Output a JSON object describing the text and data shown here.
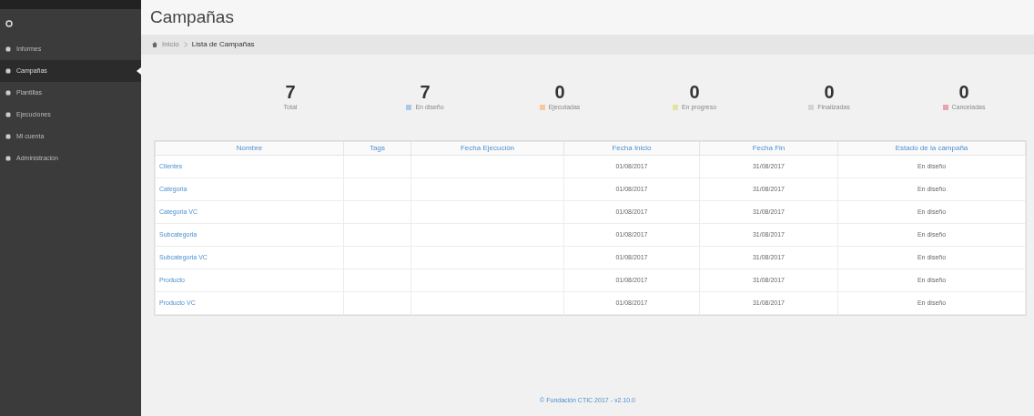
{
  "sidebar": {
    "items": [
      {
        "label": "Informes",
        "selected": false
      },
      {
        "label": "Campañas",
        "selected": true
      },
      {
        "label": "Plantillas",
        "selected": false
      },
      {
        "label": "Ejecuciones",
        "selected": false
      },
      {
        "label": "Mi cuenta",
        "selected": false
      },
      {
        "label": "Administración",
        "selected": false
      }
    ]
  },
  "page_title": "Campañas",
  "breadcrumb": [
    "Inicio",
    "Lista de Campañas"
  ],
  "stats": [
    {
      "value": "7",
      "label": "Total"
    },
    {
      "value": "7",
      "label": "En diseño",
      "color": "#a9cbe8"
    },
    {
      "value": "0",
      "label": "Ejecutadas",
      "color": "#f5c99b"
    },
    {
      "value": "0",
      "label": "En progreso",
      "color": "#e3e3a8"
    },
    {
      "value": "0",
      "label": "Finalizadas",
      "color": "#d4d4d4"
    },
    {
      "value": "0",
      "label": "Canceladas",
      "color": "#e6a3b0"
    }
  ],
  "table": {
    "columns": [
      "Nombre",
      "Tags",
      "Fecha Ejecución",
      "Fecha Inicio",
      "Fecha Fin",
      "Estado de la campaña"
    ],
    "rows": [
      [
        "Clientes",
        "",
        "",
        "01/08/2017",
        "31/08/2017",
        "En diseño"
      ],
      [
        "Categoria",
        "",
        "",
        "01/08/2017",
        "31/08/2017",
        "En diseño"
      ],
      [
        "Categoria VC",
        "",
        "",
        "01/08/2017",
        "31/08/2017",
        "En diseño"
      ],
      [
        "Subcategoria",
        "",
        "",
        "01/08/2017",
        "31/08/2017",
        "En diseño"
      ],
      [
        "Subcategoria VC",
        "",
        "",
        "01/08/2017",
        "31/08/2017",
        "En diseño"
      ],
      [
        "Producto",
        "",
        "",
        "01/08/2017",
        "31/08/2017",
        "En diseño"
      ],
      [
        "Producto VC",
        "",
        "",
        "01/08/2017",
        "31/08/2017",
        "En diseño"
      ]
    ]
  },
  "footer": "© Fundación CTIC 2017 - v2.10.0"
}
